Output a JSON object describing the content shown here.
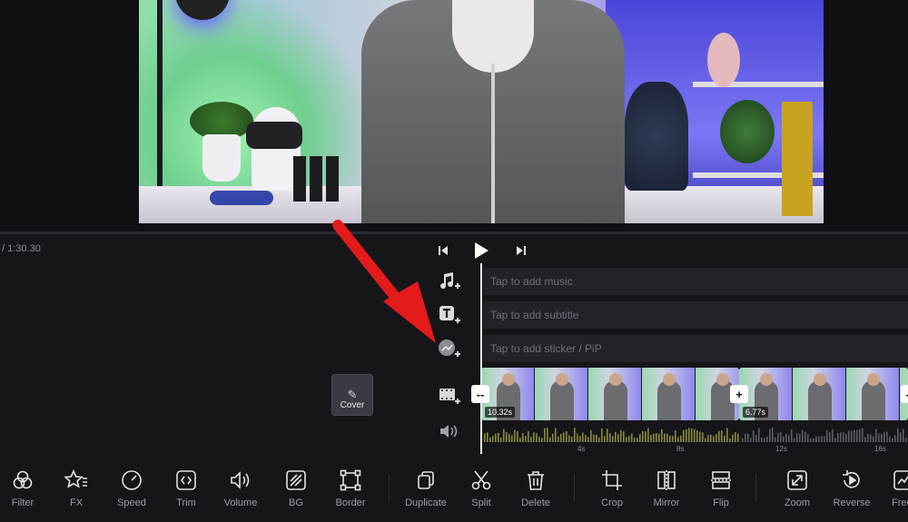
{
  "timeline": {
    "time_readout": "/ 1:30.30"
  },
  "tracks": {
    "music_placeholder": "Tap to add music",
    "subtitle_placeholder": "Tap to add subtitle",
    "sticker_placeholder": "Tap to add sticker / PiP"
  },
  "cover": {
    "label": "Cover"
  },
  "clips": [
    {
      "duration": "10.32s",
      "selected": true
    },
    {
      "duration": "6.77s",
      "selected": false
    }
  ],
  "handles": {
    "left": "--",
    "mid": "+",
    "right": "--"
  },
  "ruler_ticks": [
    "4s",
    "8s",
    "12s",
    "16s"
  ],
  "toolbar": {
    "items": [
      {
        "label": "Filter",
        "icon": "filter-icon"
      },
      {
        "label": "FX",
        "icon": "fx-star-icon"
      },
      {
        "label": "Speed",
        "icon": "speed-gauge-icon"
      },
      {
        "label": "Trim",
        "icon": "trim-icon"
      },
      {
        "label": "Volume",
        "icon": "volume-icon"
      },
      {
        "label": "BG",
        "icon": "background-icon"
      },
      {
        "label": "Border",
        "icon": "border-icon"
      },
      {
        "label": "Duplicate",
        "icon": "duplicate-icon"
      },
      {
        "label": "Split",
        "icon": "scissors-icon"
      },
      {
        "label": "Delete",
        "icon": "trash-icon"
      },
      {
        "label": "Crop",
        "icon": "crop-icon"
      },
      {
        "label": "Mirror",
        "icon": "mirror-icon"
      },
      {
        "label": "Flip",
        "icon": "flip-icon"
      },
      {
        "label": "Zoom",
        "icon": "zoom-icon"
      },
      {
        "label": "Reverse",
        "icon": "reverse-icon"
      },
      {
        "label": "Free",
        "icon": "freeze-icon"
      }
    ]
  },
  "colors": {
    "background": "#16161a",
    "selection": "#f0c419",
    "annotation_arrow": "#e31b1b"
  }
}
